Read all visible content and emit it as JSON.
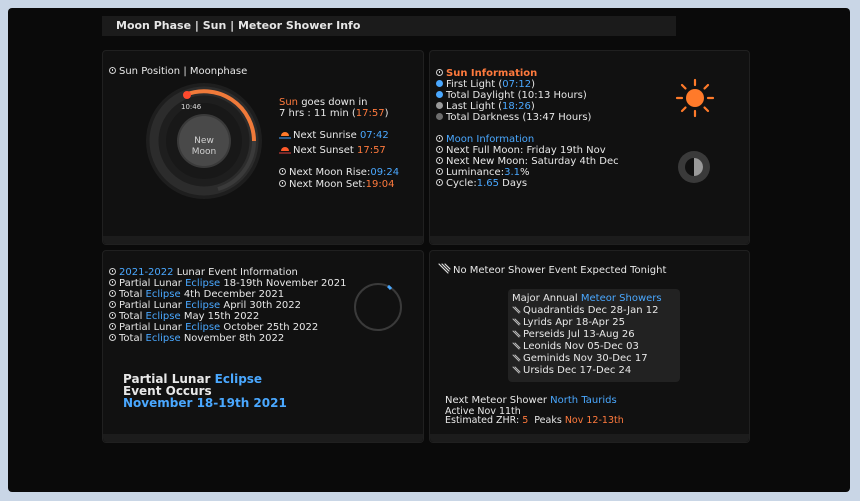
{
  "title": "Moon Phase | Sun | Meteor Shower Info",
  "sun_position": {
    "header": "Sun Position | Moonphase",
    "ring_time": "10:46",
    "moon_phase_line1": "New",
    "moon_phase_line2": "Moon",
    "sun_word": "Sun",
    "goes_down": " goes down in",
    "countdown": "7 hrs : 11 min (",
    "countdown_time": "17:57",
    "countdown_close": ")",
    "next_sunrise_label": "Next Sunrise ",
    "next_sunrise_time": "07:42",
    "next_sunset_label": "Next Sunset ",
    "next_sunset_time": "17:57",
    "moon_rise_label": "Next Moon Rise:",
    "moon_rise_time": "09:24",
    "moon_set_label": "Next Moon Set:",
    "moon_set_time": "19:04"
  },
  "sun_info": {
    "header": "Sun Information",
    "first_light_label": "First Light (",
    "first_light_time": "07:12",
    "first_light_close": ")",
    "total_daylight": "Total Daylight (10:13 Hours)",
    "last_light_label": "Last Light (",
    "last_light_time": "18:26",
    "last_light_close": ")",
    "total_darkness": "Total Darkness (13:47 Hours)",
    "moon_header": "Moon Information",
    "next_full_moon": "Next Full Moon: Friday 19th Nov",
    "next_new_moon": "Next New Moon: Saturday 4th Dec",
    "luminance_label": "Luminance:",
    "luminance_value": "3.1",
    "luminance_unit": "%",
    "cycle_label": "Cycle:",
    "cycle_value": "1.65",
    "cycle_unit": " Days",
    "colors": {
      "sun": "#ff7a2a",
      "first_light": "#4aa8ff",
      "daylight": "#4aa8ff",
      "last_light": "#9a9a9a",
      "darkness": "#7a7a7a"
    }
  },
  "lunar": {
    "years": "2021-2022",
    "header_rest": " Lunar Event Information",
    "events": [
      {
        "pre": "Partial Lunar ",
        "eclipse": "Eclipse",
        "post": " 18-19th November 2021"
      },
      {
        "pre": "Total ",
        "eclipse": "Eclipse",
        "post": " 4th December 2021"
      },
      {
        "pre": "Partial Lunar ",
        "eclipse": "Eclipse",
        "post": " April 30th 2022"
      },
      {
        "pre": "Total ",
        "eclipse": "Eclipse",
        "post": " May 15th 2022"
      },
      {
        "pre": "Partial Lunar ",
        "eclipse": "Eclipse",
        "post": " October 25th 2022"
      },
      {
        "pre": "Total ",
        "eclipse": "Eclipse",
        "post": " November 8th 2022"
      }
    ],
    "occurs_line1_pre": "Partial Lunar ",
    "occurs_line1_eclipse": "Eclipse",
    "occurs_line2": "Event Occurs",
    "occurs_date": "November 18-19th 2021"
  },
  "meteor": {
    "header": "No Meteor Shower Event Expected Tonight",
    "annual_label": "Major Annual ",
    "annual_link": "Meteor Showers",
    "showers": [
      "Quadrantids Dec 28-Jan 12",
      "Lyrids Apr 18-Apr 25",
      "Perseids Jul 13-Aug 26",
      "Leonids Nov 05-Dec 03",
      "Geminids Nov 30-Dec 17",
      "Ursids Dec 17-Dec 24"
    ],
    "next_label": "Next Meteor Shower ",
    "next_name": "North Taurids",
    "active": "Active Nov 11th",
    "zhr_label": "Estimated ZHR: ",
    "zhr_value": "5",
    "peaks_label": "  Peaks ",
    "peaks_value": "Nov 12-13th"
  }
}
